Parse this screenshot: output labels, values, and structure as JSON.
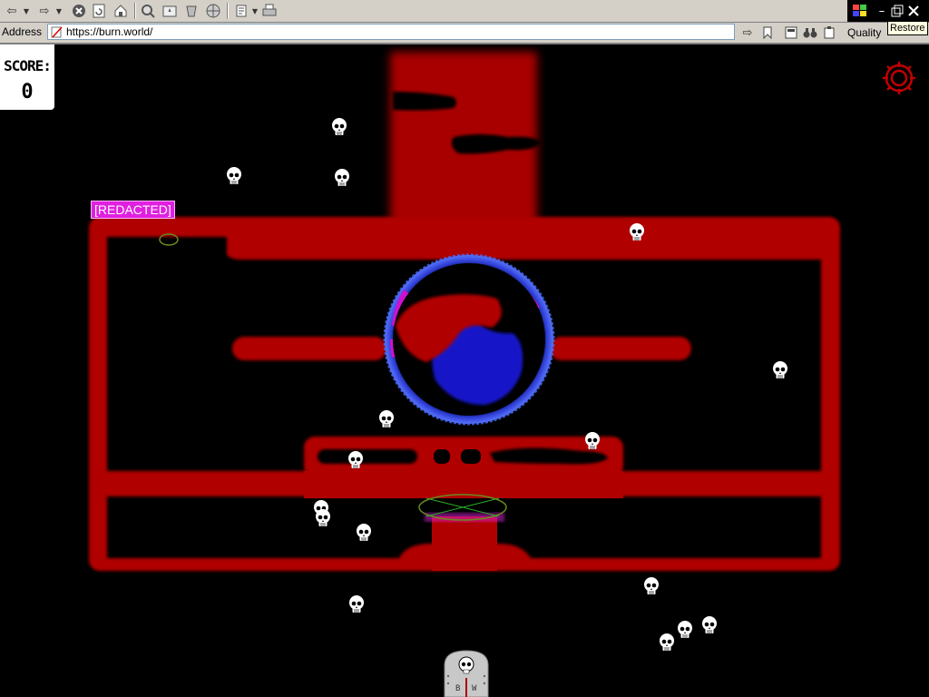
{
  "browser": {
    "address_label": "Address",
    "url": "https://burn.world/",
    "quality_label": "Quality",
    "tooltip": "Restore",
    "toolbar_icons": [
      "back-arrow-icon",
      "forward-arrow-icon",
      "stop-icon",
      "refresh-icon",
      "home-icon",
      "search-icon",
      "favorites-icon",
      "history-icon",
      "channels-icon",
      "edit-icon",
      "print-icon"
    ]
  },
  "game": {
    "score_label": "SCORE:",
    "score_value": "0",
    "player_tag": "[REDACTED]",
    "player_letters": [
      "B",
      "W"
    ],
    "colors": {
      "wall": "#b00000",
      "orb": "#1414c8",
      "accent": "#e020e0",
      "background": "#000000"
    }
  }
}
